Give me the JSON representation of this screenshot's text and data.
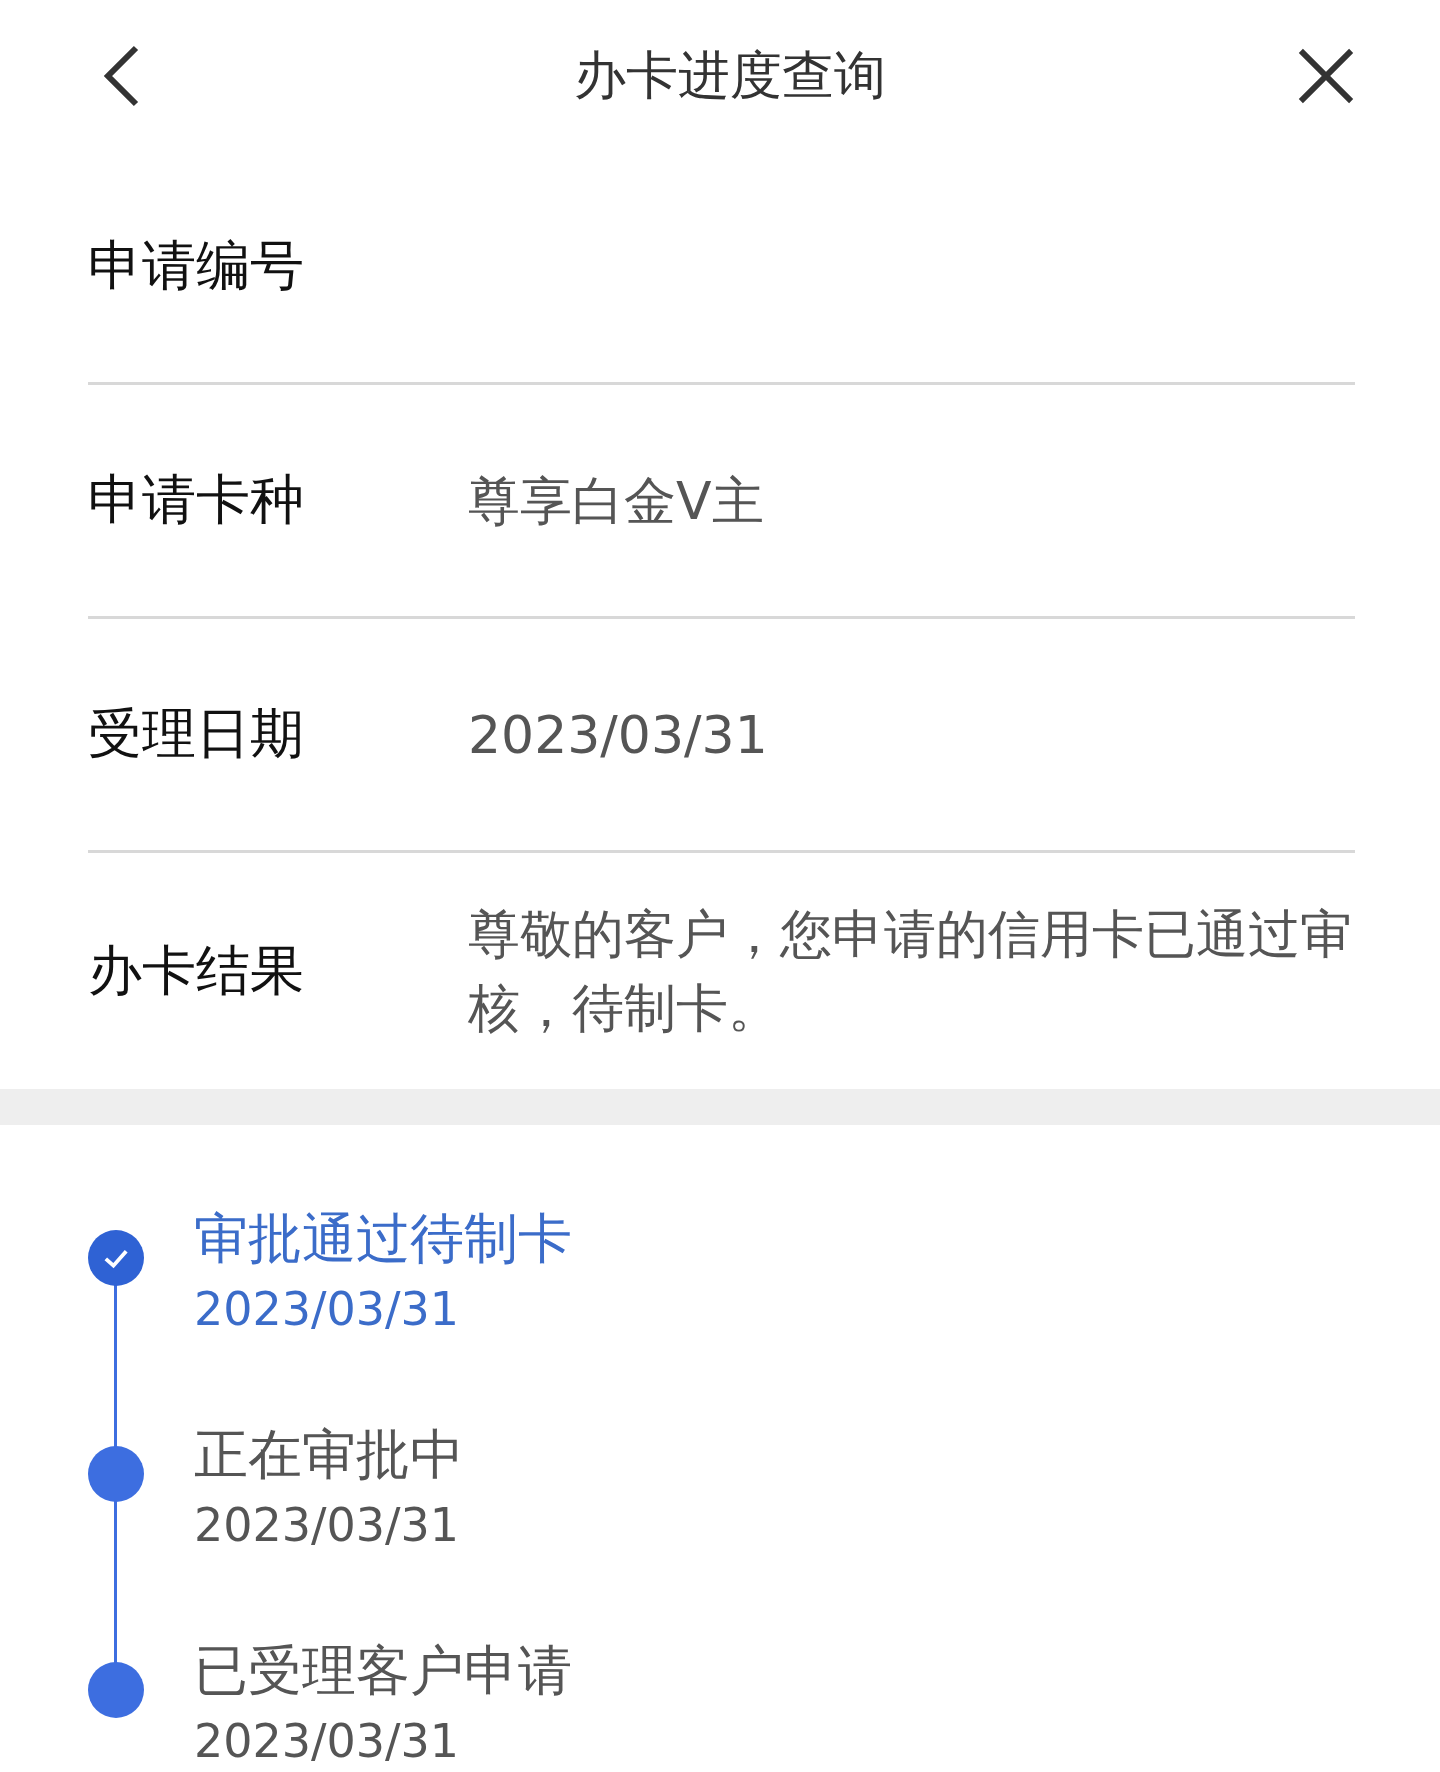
{
  "header": {
    "title": "办卡进度查询"
  },
  "fields": [
    {
      "label": "申请编号"
    },
    {
      "label": "申请卡种",
      "value": "尊享白金V主"
    },
    {
      "label": "受理日期",
      "value": "2023/03/31"
    },
    {
      "label": "办卡结果",
      "value": "尊敬的客户，您申请的信用卡已通过审核，待制卡。"
    }
  ],
  "timeline": [
    {
      "title": "审批通过待制卡",
      "date": "2023/03/31",
      "current": true
    },
    {
      "title": "正在审批中",
      "date": "2023/03/31",
      "current": false
    },
    {
      "title": "已受理客户申请",
      "date": "2023/03/31",
      "current": false
    }
  ]
}
